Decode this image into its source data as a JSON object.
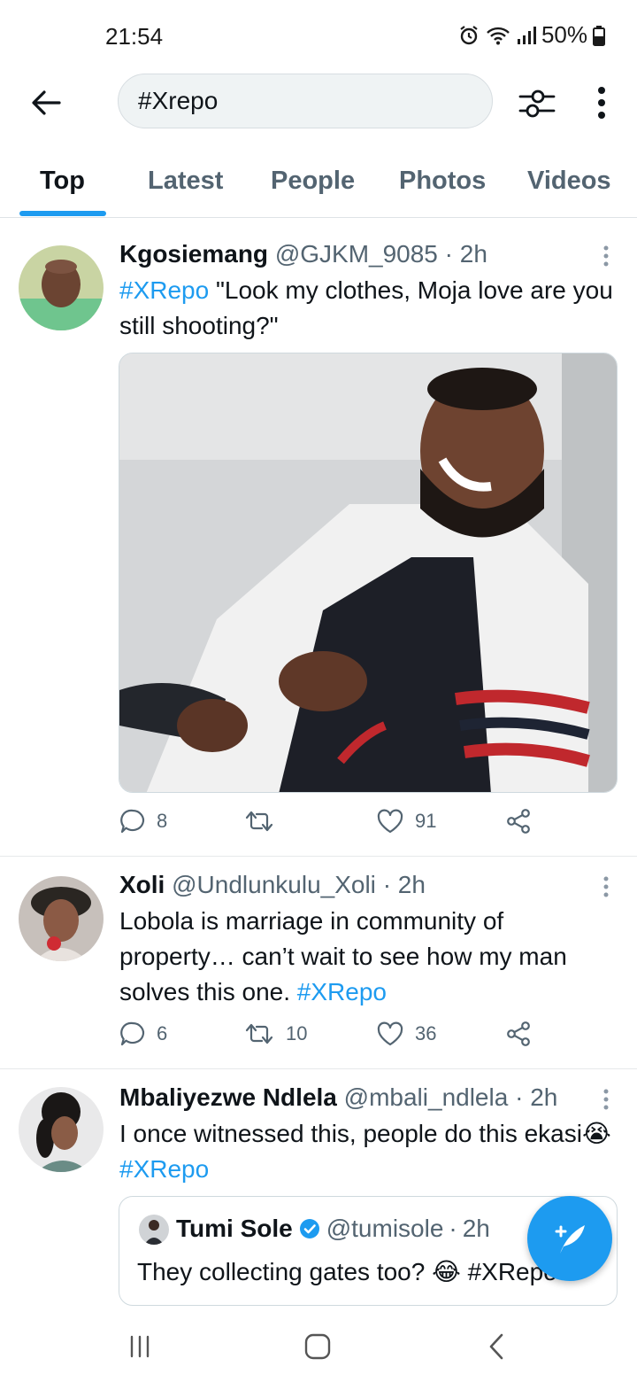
{
  "status_bar": {
    "time": "21:54",
    "battery": "50%"
  },
  "search": {
    "query": "#Xrepo"
  },
  "tabs": [
    {
      "label": "Top",
      "active": true
    },
    {
      "label": "Latest",
      "active": false
    },
    {
      "label": "People",
      "active": false
    },
    {
      "label": "Photos",
      "active": false
    },
    {
      "label": "Videos",
      "active": false
    }
  ],
  "tweets": [
    {
      "name": "Kgosiemang",
      "handle": "@GJKM_9085",
      "time": "2h",
      "hashtag": "#XRepo",
      "text": " \"Look my clothes, Moja love are you still shooting?\"",
      "has_media": true,
      "replies": "8",
      "retweets": "",
      "likes": "91"
    },
    {
      "name": "Xoli",
      "handle": "@Undlunkulu_Xoli",
      "time": "2h",
      "text": "Lobola is marriage in community of property… can’t wait to see how my man solves this one. ",
      "hashtag": "#XRepo",
      "replies": "6",
      "retweets": "10",
      "likes": "36"
    },
    {
      "name": "Mbaliyezwe Ndlela",
      "handle": "@mbali_ndlela",
      "time": "2h",
      "text": "I once witnessed this, people do this ekasi😭 ",
      "hashtag": "#XRepo",
      "quote": {
        "name": "Tumi Sole",
        "verified": true,
        "handle": "@tumisole",
        "time": "2h",
        "text": "They collecting gates too? 😂 #XRepo"
      }
    }
  ],
  "colors": {
    "accent": "#1d9bf0",
    "text": "#0f1419",
    "secondary": "#536471"
  },
  "icons": [
    "back-arrow-icon",
    "filter-icon",
    "more-vertical-icon",
    "reply-icon",
    "retweet-icon",
    "like-icon",
    "share-icon",
    "compose-icon",
    "verified-icon"
  ]
}
